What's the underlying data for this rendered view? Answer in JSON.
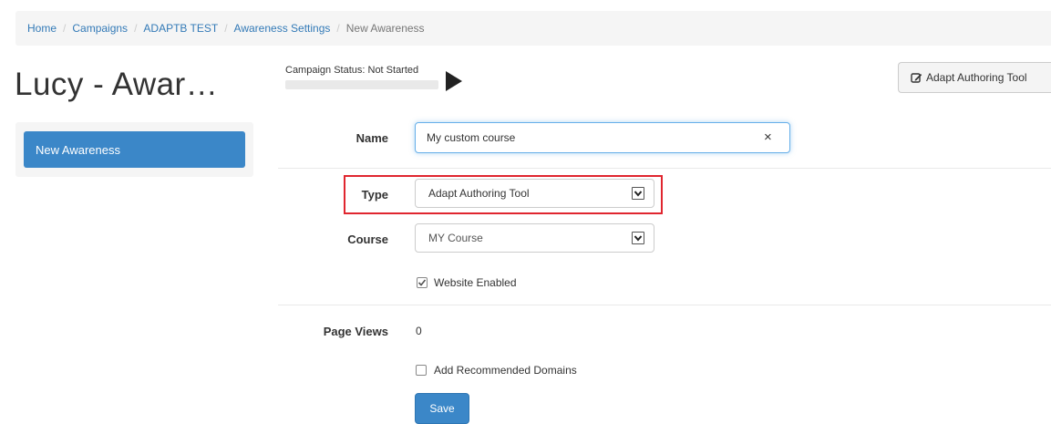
{
  "breadcrumb": {
    "items": [
      "Home",
      "Campaigns",
      "ADAPTB TEST",
      "Awareness Settings",
      "New Awareness"
    ],
    "separator": "/"
  },
  "page": {
    "title": "Lucy - Awar…"
  },
  "campaign_status": {
    "label": "Campaign Status:",
    "value": "Not Started"
  },
  "header": {
    "tool_button_label": "Adapt Authoring Tool",
    "tool_button_icon": "edit-icon"
  },
  "sidebar": {
    "items": [
      {
        "label": "New Awareness",
        "active": true
      }
    ]
  },
  "form": {
    "name": {
      "label": "Name",
      "value": "My custom course",
      "clear_icon": "×"
    },
    "type": {
      "label": "Type",
      "selected": "Adapt Authoring Tool"
    },
    "course": {
      "label": "Course",
      "selected": "MY Course"
    },
    "website_enabled": {
      "label": "Website Enabled",
      "checked": true
    },
    "page_views": {
      "label": "Page Views",
      "value": "0"
    },
    "add_recommended_domains": {
      "label": "Add Recommended Domains",
      "checked": false
    },
    "save_label": "Save"
  },
  "colors": {
    "primary": "#3b87c8",
    "link": "#337ab7",
    "highlight_box": "#e0262f"
  }
}
